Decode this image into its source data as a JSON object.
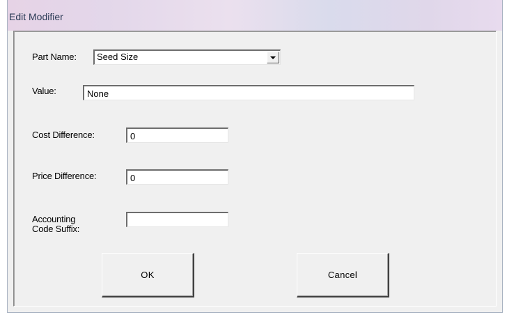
{
  "window": {
    "title": "Edit Modifier"
  },
  "form": {
    "part_name_label": "Part Name:",
    "part_name_value": "Seed Size",
    "value_label": "Value:",
    "value_value": "None",
    "cost_label": "Cost Difference:",
    "cost_value": "0",
    "price_label": "Price Difference:",
    "price_value": "0",
    "accounting_label_line1": "Accounting",
    "accounting_label_line2": "Code Suffix:",
    "accounting_value": ""
  },
  "buttons": {
    "ok_label": "OK",
    "cancel_label": "Cancel"
  }
}
